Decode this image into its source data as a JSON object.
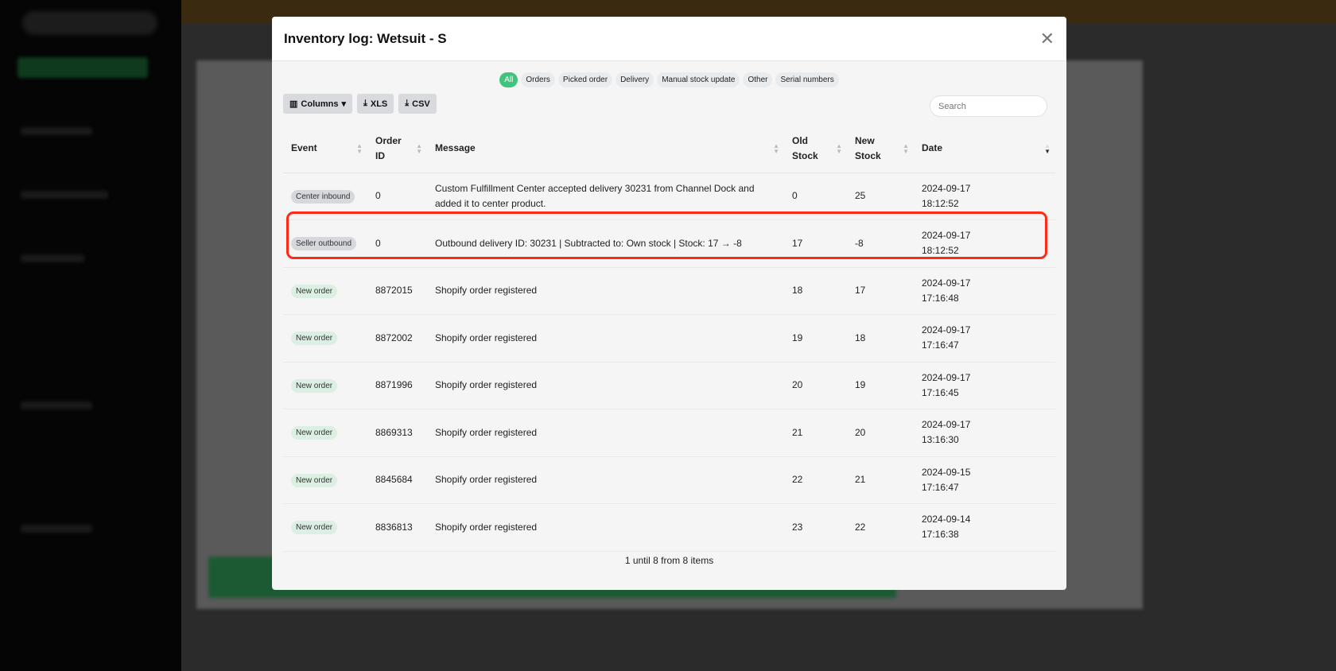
{
  "modal": {
    "title": "Inventory log: Wetsuit - S",
    "close_icon": "close-icon"
  },
  "filters": [
    {
      "label": "All",
      "active": true
    },
    {
      "label": "Orders"
    },
    {
      "label": "Picked order"
    },
    {
      "label": "Delivery"
    },
    {
      "label": "Manual stock update"
    },
    {
      "label": "Other"
    },
    {
      "label": "Serial numbers"
    }
  ],
  "toolbar": {
    "columns": "Columns",
    "xls": "XLS",
    "csv": "CSV",
    "search_placeholder": "Search"
  },
  "table": {
    "headers": [
      "Event",
      "Order ID",
      "Message",
      "Old Stock",
      "New Stock",
      "Date"
    ],
    "rows": [
      {
        "event": "Center inbound",
        "tone": "gray",
        "order": "0",
        "message": "Custom Fulfillment Center accepted delivery 30231 from Channel Dock and added it to center product.",
        "old": "0",
        "new": "25",
        "date": "2024-09-17",
        "time": "18:12:52"
      },
      {
        "event": "Seller outbound",
        "tone": "gray",
        "order": "0",
        "message": "Outbound delivery ID: 30231 | Subtracted to: Own stock | Stock: 17 → -8",
        "old": "17",
        "new": "-8",
        "date": "2024-09-17",
        "time": "18:12:52",
        "highlighted": true
      },
      {
        "event": "New order",
        "tone": "green",
        "order": "8872015",
        "message": "Shopify order registered",
        "old": "18",
        "new": "17",
        "date": "2024-09-17",
        "time": "17:16:48"
      },
      {
        "event": "New order",
        "tone": "green",
        "order": "8872002",
        "message": "Shopify order registered",
        "old": "19",
        "new": "18",
        "date": "2024-09-17",
        "time": "17:16:47"
      },
      {
        "event": "New order",
        "tone": "green",
        "order": "8871996",
        "message": "Shopify order registered",
        "old": "20",
        "new": "19",
        "date": "2024-09-17",
        "time": "17:16:45"
      },
      {
        "event": "New order",
        "tone": "green",
        "order": "8869313",
        "message": "Shopify order registered",
        "old": "21",
        "new": "20",
        "date": "2024-09-17",
        "time": "13:16:30"
      },
      {
        "event": "New order",
        "tone": "green",
        "order": "8845684",
        "message": "Shopify order registered",
        "old": "22",
        "new": "21",
        "date": "2024-09-15",
        "time": "17:16:47"
      },
      {
        "event": "New order",
        "tone": "green",
        "order": "8836813",
        "message": "Shopify order registered",
        "old": "23",
        "new": "22",
        "date": "2024-09-14",
        "time": "17:16:38"
      }
    ]
  },
  "footer": "1 until 8 from 8 items",
  "colors": {
    "accent": "#3ec47c",
    "highlight": "#ff2a1a"
  }
}
